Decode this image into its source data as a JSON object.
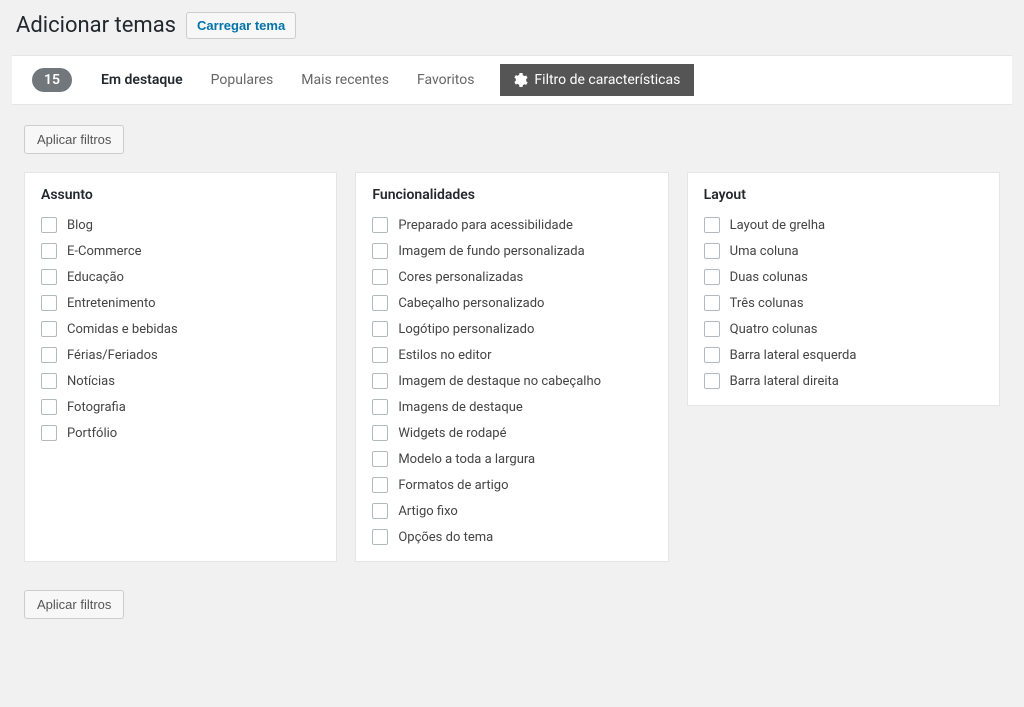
{
  "header": {
    "title": "Adicionar temas",
    "upload_label": "Carregar tema"
  },
  "filter_bar": {
    "count": "15",
    "tabs": [
      {
        "label": "Em destaque"
      },
      {
        "label": "Populares"
      },
      {
        "label": "Mais recentes"
      },
      {
        "label": "Favoritos"
      }
    ],
    "feature_filter_label": "Filtro de características"
  },
  "buttons": {
    "apply_filters": "Aplicar filtros"
  },
  "groups": {
    "subject": {
      "title": "Assunto",
      "items": [
        "Blog",
        "E-Commerce",
        "Educação",
        "Entretenimento",
        "Comidas e bebidas",
        "Férias/Feriados",
        "Notícias",
        "Fotografia",
        "Portfólio"
      ]
    },
    "features": {
      "title": "Funcionalidades",
      "items": [
        "Preparado para acessibilidade",
        "Imagem de fundo personalizada",
        "Cores personalizadas",
        "Cabeçalho personalizado",
        "Logótipo personalizado",
        "Estilos no editor",
        "Imagem de destaque no cabeçalho",
        "Imagens de destaque",
        "Widgets de rodapé",
        "Modelo a toda a largura",
        "Formatos de artigo",
        "Artigo fixo",
        "Opções do tema"
      ]
    },
    "layout": {
      "title": "Layout",
      "items": [
        "Layout de grelha",
        "Uma coluna",
        "Duas colunas",
        "Três colunas",
        "Quatro colunas",
        "Barra lateral esquerda",
        "Barra lateral direita"
      ]
    }
  }
}
